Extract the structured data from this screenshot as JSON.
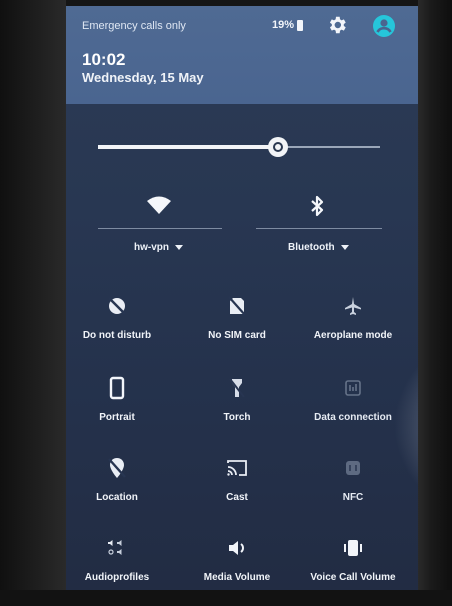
{
  "header": {
    "status_text": "Emergency calls only",
    "battery": "19%",
    "time": "10:02",
    "date": "Wednesday, 15 May"
  },
  "brightness": {
    "level": 0.64
  },
  "connections": {
    "wifi_label": "hw-vpn",
    "bluetooth_label": "Bluetooth"
  },
  "tiles": [
    {
      "label": "Do not disturb",
      "icon": "do-not-disturb-icon"
    },
    {
      "label": "No SIM card",
      "icon": "no-sim-icon"
    },
    {
      "label": "Aeroplane mode",
      "icon": "airplane-icon"
    },
    {
      "label": "Portrait",
      "icon": "portrait-icon"
    },
    {
      "label": "Torch",
      "icon": "torch-icon"
    },
    {
      "label": "Data connection",
      "icon": "data-icon"
    },
    {
      "label": "Location",
      "icon": "location-off-icon"
    },
    {
      "label": "Cast",
      "icon": "cast-icon"
    },
    {
      "label": "NFC",
      "icon": "nfc-icon"
    },
    {
      "label": "Audioprofiles",
      "icon": "audio-profiles-icon"
    },
    {
      "label": "Media Volume",
      "icon": "volume-icon"
    },
    {
      "label": "Voice Call Volume",
      "icon": "vibrate-icon"
    }
  ],
  "colors": {
    "header_bg": "#4a6590",
    "panel_bg": "#273551",
    "icon_white": "#f2f5fa"
  }
}
